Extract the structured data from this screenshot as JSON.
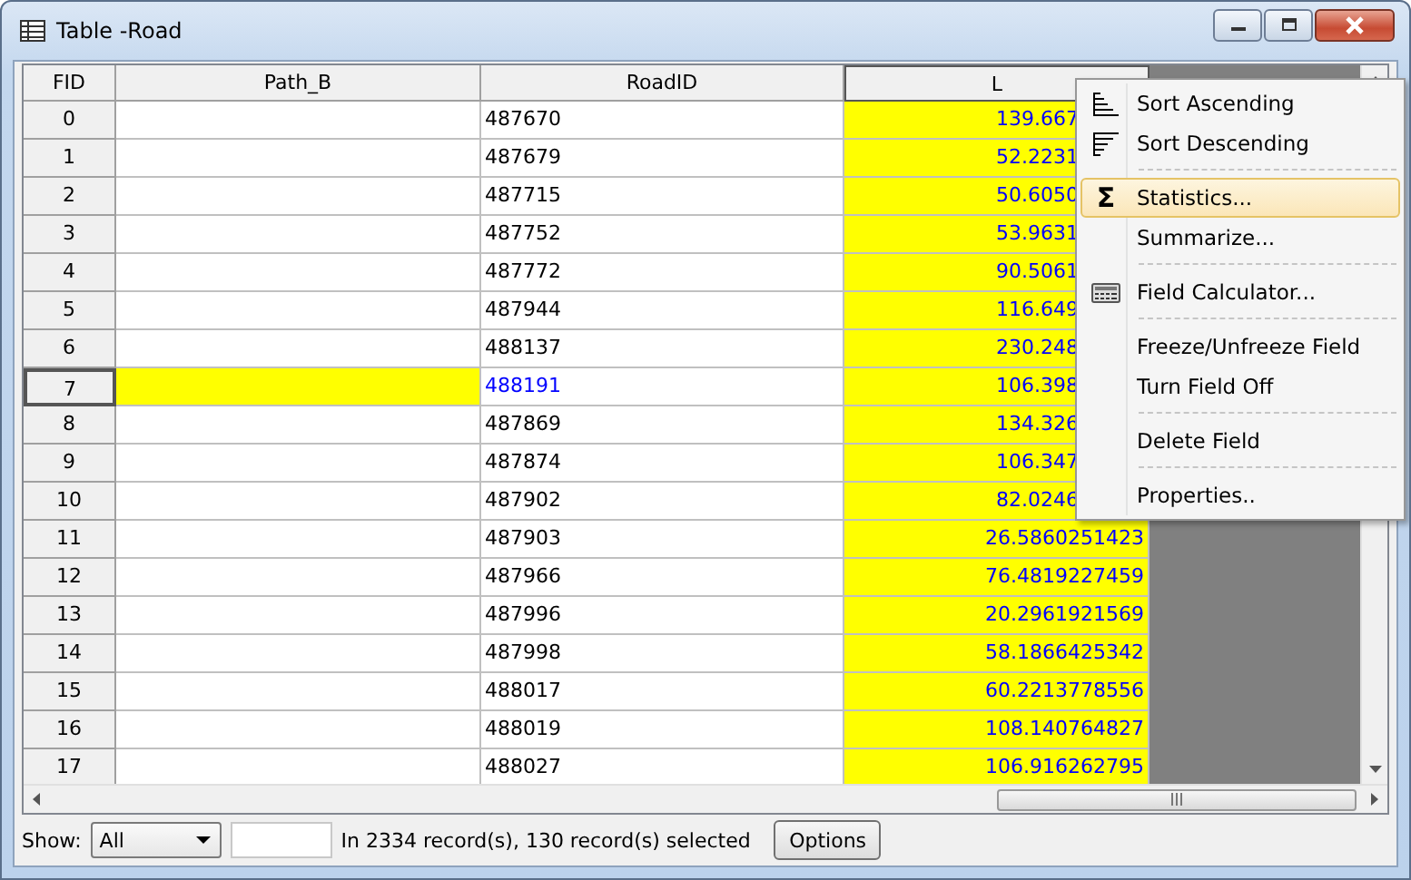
{
  "window": {
    "title": "Table -Road"
  },
  "table": {
    "columns": [
      {
        "label": "FID",
        "selected": false
      },
      {
        "label": "Path_B",
        "selected": false
      },
      {
        "label": "RoadID",
        "selected": false
      },
      {
        "label": "L",
        "selected": true
      }
    ],
    "rows": [
      {
        "fid": "0",
        "path_b": "",
        "road_id": "487670",
        "l": "139.667",
        "selected": false
      },
      {
        "fid": "1",
        "path_b": "",
        "road_id": "487679",
        "l": "52.2231",
        "selected": false
      },
      {
        "fid": "2",
        "path_b": "",
        "road_id": "487715",
        "l": "50.6050",
        "selected": false
      },
      {
        "fid": "3",
        "path_b": "",
        "road_id": "487752",
        "l": "53.9631",
        "selected": false
      },
      {
        "fid": "4",
        "path_b": "",
        "road_id": "487772",
        "l": "90.5061",
        "selected": false
      },
      {
        "fid": "5",
        "path_b": "",
        "road_id": "487944",
        "l": "116.649",
        "selected": false
      },
      {
        "fid": "6",
        "path_b": "",
        "road_id": "488137",
        "l": "230.248",
        "selected": false
      },
      {
        "fid": "7",
        "path_b": "",
        "road_id": "488191",
        "l": "106.398",
        "selected": true
      },
      {
        "fid": "8",
        "path_b": "",
        "road_id": "487869",
        "l": "134.326",
        "selected": false
      },
      {
        "fid": "9",
        "path_b": "",
        "road_id": "487874",
        "l": "106.347",
        "selected": false
      },
      {
        "fid": "10",
        "path_b": "",
        "road_id": "487902",
        "l": "82.0246",
        "selected": false
      },
      {
        "fid": "11",
        "path_b": "",
        "road_id": "487903",
        "l": "26.5860251423",
        "selected": false
      },
      {
        "fid": "12",
        "path_b": "",
        "road_id": "487966",
        "l": "76.4819227459",
        "selected": false
      },
      {
        "fid": "13",
        "path_b": "",
        "road_id": "487996",
        "l": "20.2961921569",
        "selected": false
      },
      {
        "fid": "14",
        "path_b": "",
        "road_id": "487998",
        "l": "58.1866425342",
        "selected": false
      },
      {
        "fid": "15",
        "path_b": "",
        "road_id": "488017",
        "l": "60.2213778556",
        "selected": false
      },
      {
        "fid": "16",
        "path_b": "",
        "road_id": "488019",
        "l": "108.140764827",
        "selected": false
      },
      {
        "fid": "17",
        "path_b": "",
        "road_id": "488027",
        "l": "106.916262795",
        "selected": false
      }
    ]
  },
  "context_menu": {
    "groups": [
      [
        {
          "label": "Sort Ascending",
          "kind": "ascending",
          "selected": false
        },
        {
          "label": "Sort Descending",
          "kind": "descending",
          "selected": false
        }
      ],
      [
        {
          "label": "Statistics...",
          "kind": "glyph",
          "glyph": "Σ",
          "selected": true
        },
        {
          "label": "Summarize...",
          "kind": "plain",
          "selected": false
        }
      ],
      [
        {
          "label": "Field Calculator...",
          "kind": "calculator",
          "selected": false
        }
      ],
      [
        {
          "label": "Freeze/Unfreeze Field",
          "kind": "plain",
          "selected": false
        },
        {
          "label": "Turn Field Off",
          "kind": "plain",
          "selected": false
        }
      ],
      [
        {
          "label": "Delete Field",
          "kind": "plain",
          "selected": false
        }
      ],
      [
        {
          "label": "Properties..",
          "kind": "plain",
          "selected": false
        }
      ]
    ]
  },
  "status_bar": {
    "show_label": "Show:",
    "show_value": "All",
    "records_text": "In 2334 record(s), 130 record(s) selected",
    "options_button": "Options"
  }
}
